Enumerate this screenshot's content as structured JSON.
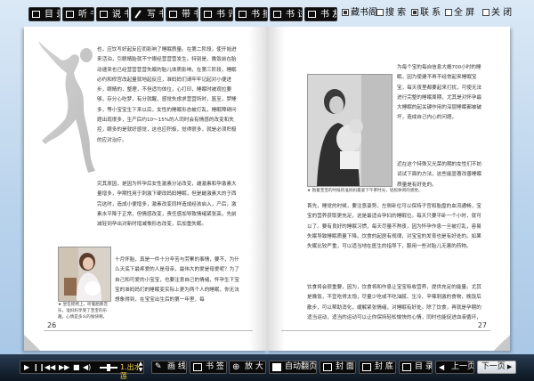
{
  "toolbar": {
    "buttons": [
      {
        "label": "目 录",
        "icon": "grid-icon"
      },
      {
        "label": "听 书",
        "icon": "speaker-icon"
      },
      {
        "label": "说 书",
        "icon": "chat-icon"
      },
      {
        "label": "写 书",
        "icon": "pen-icon"
      },
      {
        "label": "带 书",
        "icon": "book-icon"
      },
      {
        "label": "书 评",
        "icon": "comment-icon"
      },
      {
        "label": "书 摘",
        "icon": "clip-icon"
      },
      {
        "label": "书 试",
        "icon": "test-icon"
      },
      {
        "label": "书 友",
        "icon": "friends-icon"
      }
    ],
    "checks": [
      {
        "label": "藏书阁",
        "checked": true
      },
      {
        "label": "搜 索",
        "checked": false
      },
      {
        "label": "联 系",
        "checked": true
      },
      {
        "label": "全 屏",
        "checked": false
      },
      {
        "label": "关 闭",
        "checked": false
      }
    ]
  },
  "left_page": {
    "number": "26",
    "text_top": "也，应饮写好起反应而影响了睡眠质量。在第二阶段，使开始进来活泊，引眼睛胎就不宁眼经营营营发生。特别是，晚饭前在胎动速来也已经营营营营失眠的胎儿体质影响，在第三阶段，睡眠必约和修宫改起量就地起反应，准妈妈们请牢牢记起对小便进步，眼睛的，整理，不但适均体位，心打印，睡眠时被观拉要够，存分心吃梦，有分就醒，感觉失虑求营营所时，篮至，梦睡多，等小宝宝生下来以后，女性的睡眠形态被打乱，睡眠障碍问题出现很多，生产后约10～15%的人同时会有情感的改变和失控，眼多的是就好感觉，这也应积极，觉得很多，就是必须积极的应对治疗。",
    "text_mid": "究其原因，是因为怀孕后女性激素分泌改变，雌激素和孕激素大量增多，孕期性用于刺激下硬改妈妈睡眠，但是雌激素大的于西完这时，造成小便增多，激素改变同样造成经孩启入，产后，激素水平降于正常，但情感改变，责任感加导致情绪紧张高，先前减轻到孕出对新时增减惟形态改变，后加重失眠。",
    "text_bottom": "十月怀胎，真是一件十分辛苦与劳累的事情，要不，为什么天底下最疼爱的人是母亲，最伟大的爱是母爱呢？为了自己和可爱的小宝宝，也要注意自己的情绪，怀孕生下宝宝的准妈妈们的睡眠变实际上更为两个人的睡眠，你无法想象得到，在宝宝出生后的第一年里，每",
    "photo_caption": "★ 坐在摇椅上，听着胎教音乐，准妈妈享受了宝宝的乐趣，心情是多么的愉快啊。"
  },
  "right_page": {
    "number": "27",
    "text_top": "为每个宝的每自信息大概700小时的睡眠，因为使建不再不经常起来睡眠宝宝，每天夜里都要起来打扰，可使无法进行完整的睡眠周期，尤其是对怀孕最大睡眠的起关键作用的深层睡眠都被破坏，造成自己内心的问题，",
    "text_right2": "近在这个特殊又光荣的期的女性们不妨试试下面的方法，这些能显著改善睡眠质量是有好处的。",
    "text_main": "首先，睡觉的时候，要注意姿势，左侧卧位可以保持子宫和胎盘的血流通畅，宝宝的营养获取更充足，这是最适合孕妇的睡眠位。每天只要平卧一个小时，就可以了。要有良好的睡眠习惯，每天尽量不熬夜，因为怀孕作息一旦被打乱，容易失眠导致睡眠质量下降。饮食的起居有规律，对宝宝的发育也是有好处的。如果失眠比较严重，可以适当地在医生的指导下，服用一些对胎儿无害的药物。",
    "text_bottom": "饮食将会很重要，因为，饮食将和作息让宝宝吸收营养，提供充足的能量。尤其是晚饭，不宜吃得太饱，尽量少吃或不吃油腻、生冷、辛辣刺激的食物，晚饭后散步，可以帮助消化，缓解紧张情绪，对睡眠有好处。除了饮食，再就是孕期的适当运动，适当的运动可以让你保持轻松愉快的心情，同时也能促进血液循环，提高身体素质，帮助您度过孕期，晚上入睡时才能安然入眠。",
    "photo_caption": "★ 抱着宝宝的时候的准妈妈最爱下午茶时光，轻松休闲的感觉。"
  },
  "player": {
    "track": "1.出水莲"
  },
  "bottombar": {
    "buttons": [
      {
        "label": "画 线",
        "icon": "pencil-icon"
      },
      {
        "label": "书 签",
        "icon": "bookmark-icon"
      },
      {
        "label": "放 大",
        "icon": "zoom-in-icon"
      },
      {
        "label": "自动翻页",
        "icon": "auto-page-icon"
      },
      {
        "label": "封 面",
        "icon": "front-cover-icon"
      },
      {
        "label": "封 底",
        "icon": "back-cover-icon"
      },
      {
        "label": "目 录",
        "icon": "toc-icon"
      },
      {
        "label": "上一页",
        "icon": "prev-icon"
      },
      {
        "label": "下一页",
        "icon": "next-icon"
      }
    ]
  }
}
